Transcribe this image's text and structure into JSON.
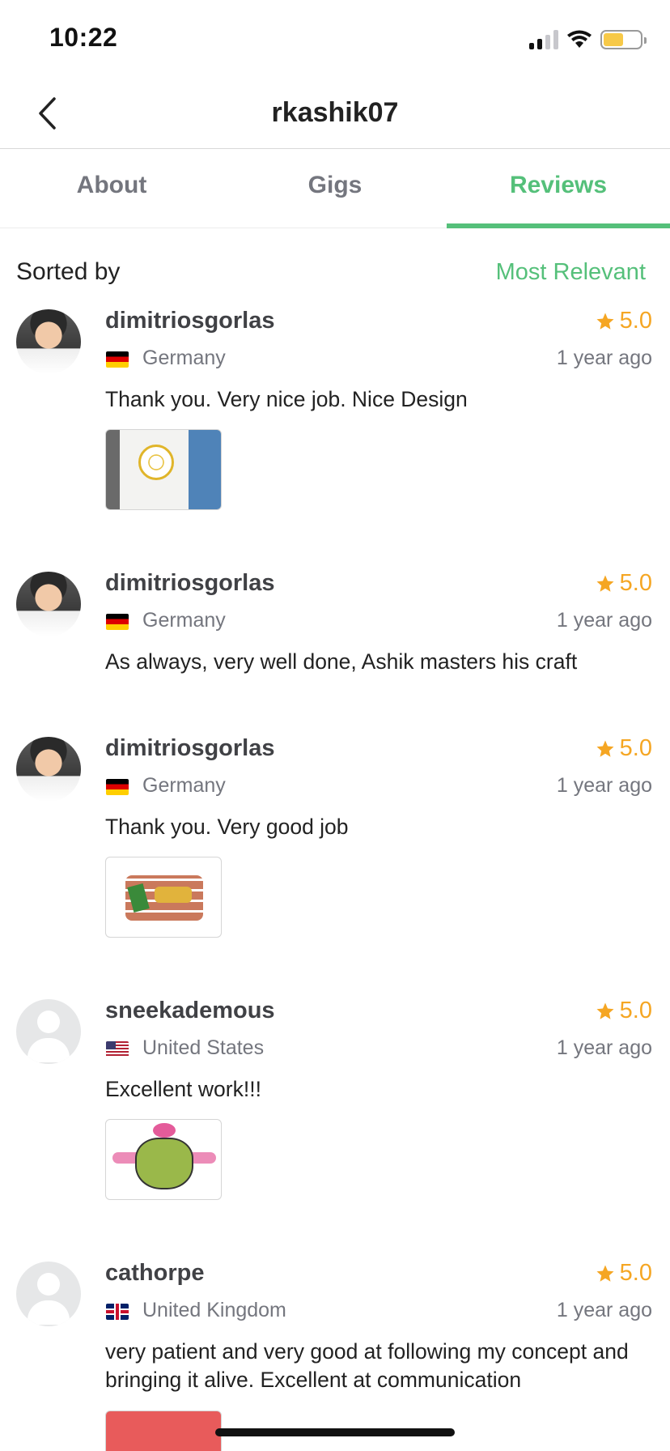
{
  "status_bar": {
    "time": "10:22"
  },
  "nav": {
    "title": "rkashik07"
  },
  "tabs": [
    {
      "label": "About"
    },
    {
      "label": "Gigs"
    },
    {
      "label": "Reviews",
      "active": true
    }
  ],
  "sort": {
    "label": "Sorted by",
    "value": "Most Relevant"
  },
  "reviews": [
    {
      "user": "dimitriosgorlas",
      "rating": "5.0",
      "country": "Germany",
      "time": "1 year ago",
      "text": "Thank you. Very nice job. Nice Design",
      "flag": "de"
    },
    {
      "user": "dimitriosgorlas",
      "rating": "5.0",
      "country": "Germany",
      "time": "1 year ago",
      "text": "As always, very well done, Ashik masters his craft",
      "flag": "de"
    },
    {
      "user": "dimitriosgorlas",
      "rating": "5.0",
      "country": "Germany",
      "time": "1 year ago",
      "text": "Thank you. Very good job",
      "flag": "de"
    },
    {
      "user": "sneekademous",
      "rating": "5.0",
      "country": "United States",
      "time": "1 year ago",
      "text": "Excellent work!!!",
      "flag": "us"
    },
    {
      "user": "cathorpe",
      "rating": "5.0",
      "country": "United Kingdom",
      "time": "1 year ago",
      "text": "very patient and very good at following my concept and bringing it alive.  Excellent at communication",
      "flag": "uk"
    }
  ],
  "colors": {
    "accent": "#55c07a",
    "star": "#f5a623",
    "muted": "#74767e"
  },
  "icons": {
    "back": "chevron-left-icon",
    "star": "star-icon"
  }
}
